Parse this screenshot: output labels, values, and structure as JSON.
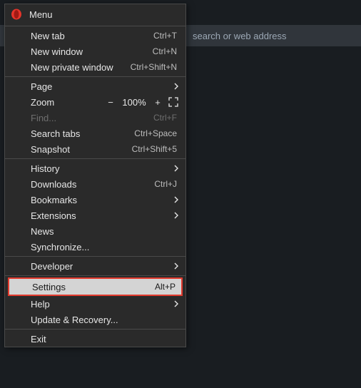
{
  "background": {
    "search_placeholder": "search or web address"
  },
  "menu": {
    "title": "Menu",
    "new_tab": {
      "label": "New tab",
      "shortcut": "Ctrl+T"
    },
    "new_window": {
      "label": "New window",
      "shortcut": "Ctrl+N"
    },
    "new_private": {
      "label": "New private window",
      "shortcut": "Ctrl+Shift+N"
    },
    "page": {
      "label": "Page"
    },
    "zoom": {
      "label": "Zoom",
      "percent": "100%",
      "minus": "−",
      "plus": "+"
    },
    "find": {
      "label": "Find...",
      "shortcut": "Ctrl+F"
    },
    "search_tabs": {
      "label": "Search tabs",
      "shortcut": "Ctrl+Space"
    },
    "snapshot": {
      "label": "Snapshot",
      "shortcut": "Ctrl+Shift+5"
    },
    "history": {
      "label": "History"
    },
    "downloads": {
      "label": "Downloads",
      "shortcut": "Ctrl+J"
    },
    "bookmarks": {
      "label": "Bookmarks"
    },
    "extensions": {
      "label": "Extensions"
    },
    "news": {
      "label": "News"
    },
    "synchronize": {
      "label": "Synchronize..."
    },
    "developer": {
      "label": "Developer"
    },
    "settings": {
      "label": "Settings",
      "shortcut": "Alt+P"
    },
    "help": {
      "label": "Help"
    },
    "update": {
      "label": "Update & Recovery..."
    },
    "exit": {
      "label": "Exit"
    }
  }
}
